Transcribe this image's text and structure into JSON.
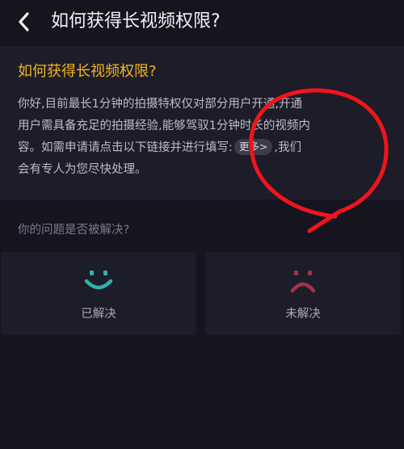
{
  "header": {
    "title": "如何获得长视频权限?"
  },
  "article": {
    "heading": "如何获得长视频权限?",
    "lines": [
      "你好,目前最长1分钟的拍摄特权仅对部分用户开通,开通",
      "用户需具备充足的拍摄经验,能够驾驭1分钟时长的视频内",
      "容。如需申请请点击以下链接并进行填写:",
      ",我们",
      "会有专人为您尽快处理。"
    ],
    "more_link": "更多>"
  },
  "feedback": {
    "question": "你的问题是否被解决?",
    "solved_label": "已解决",
    "unsolved_label": "未解决"
  },
  "colors": {
    "background": "#15141f",
    "card": "#1d1c29",
    "heading_accent": "#f2b61c",
    "solved_face": "#2bb3ad",
    "unsolved_face": "#a13447",
    "annotation_red": "#f0141e"
  },
  "icons": {
    "back": "chevron-left-icon",
    "solved": "smiley-face-icon",
    "unsolved": "sad-face-icon"
  }
}
